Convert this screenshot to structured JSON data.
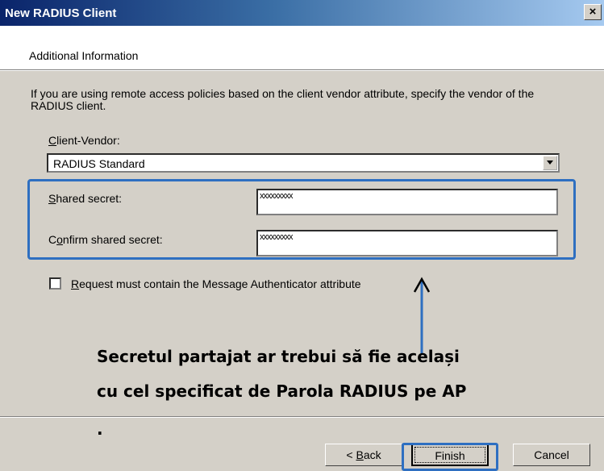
{
  "window": {
    "title": "New RADIUS Client",
    "close_glyph": "×"
  },
  "header": {
    "title": "Additional Information"
  },
  "description": "If you are using remote access policies based on the client vendor attribute, specify the vendor of the RADIUS client.",
  "client_vendor": {
    "label_key": "C",
    "label_rest": "lient-Vendor:",
    "selected": "RADIUS Standard"
  },
  "shared_secret": {
    "label_key": "S",
    "label_rest": "hared secret:",
    "value": "xxxxxxxxx"
  },
  "confirm_secret": {
    "label_pre": "C",
    "label_key": "o",
    "label_rest": "nfirm shared secret:",
    "value": "xxxxxxxxx"
  },
  "checkbox": {
    "label_key": "R",
    "label_rest": "equest must contain the Message Authenticator attribute",
    "checked": false
  },
  "annotation": {
    "line1": "Secretul partajat ar trebui să fie același",
    "line2": "cu cel specificat de Parola RADIUS pe AP",
    "dot": ".",
    "highlight_color": "#2e6fc1"
  },
  "buttons": {
    "back_prefix": "< ",
    "back_key": "B",
    "back_rest": "ack",
    "finish": "Finish",
    "cancel": "Cancel"
  }
}
